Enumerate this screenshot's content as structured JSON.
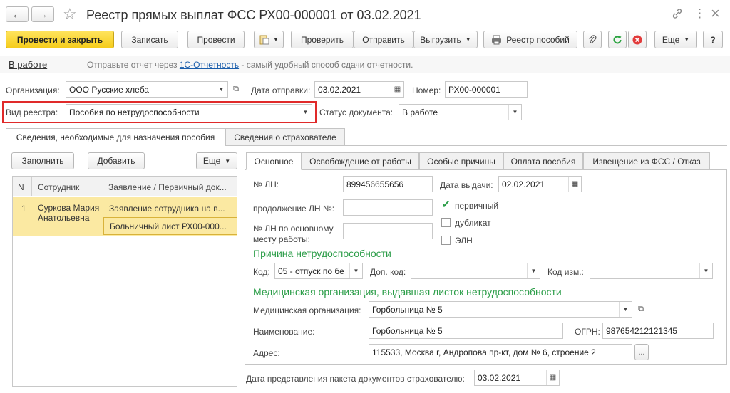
{
  "window": {
    "title": "Реестр прямых выплат ФСС РХ00-000001 от 03.02.2021",
    "back_icon": "←",
    "forward_icon": "→",
    "star_icon": "☆",
    "link_icon": "🔗",
    "menu_icon": "⋮",
    "close_icon": "×"
  },
  "toolbar": {
    "post_close": "Провести и закрыть",
    "save": "Записать",
    "post": "Провести",
    "check": "Проверить",
    "send": "Отправить",
    "export": "Выгрузить",
    "registry": "Реестр пособий",
    "more": "Еще",
    "help": "?"
  },
  "status_bar": {
    "status_link": "В работе",
    "hint_prefix": "Отправьте отчет через ",
    "hint_link": "1С-Отчетность",
    "hint_suffix": " - самый удобный способ сдачи отчетности."
  },
  "form": {
    "org_label": "Организация:",
    "org_value": "ООО Русские хлеба",
    "send_date_label": "Дата отправки:",
    "send_date_value": "03.02.2021",
    "number_label": "Номер:",
    "number_value": "РХ00-000001",
    "registry_type_label": "Вид реестра:",
    "registry_type_value": "Пособия по нетрудоспособности",
    "doc_status_label": "Статус документа:",
    "doc_status_value": "В работе"
  },
  "main_tabs": [
    "Сведения, необходимые для назначения пособия",
    "Сведения о страхователе"
  ],
  "left_panel": {
    "fill_button": "Заполнить",
    "add_button": "Добавить",
    "more_button": "Еще",
    "columns": [
      "N",
      "Сотрудник",
      "Заявление / Первичный док..."
    ],
    "rows": [
      {
        "n": "1",
        "employee": "Суркова Мария Анатольевна",
        "doc1": "Заявление сотрудника на в...",
        "doc2": "Больничный лист РХ00-000..."
      }
    ]
  },
  "detail_tabs": [
    "Основное",
    "Освобождение от работы",
    "Особые причины",
    "Оплата пособия",
    "Извещение из ФСС / Отказ"
  ],
  "detail": {
    "ln_label": "№ ЛН:",
    "ln_value": "899456655656",
    "issue_date_label": "Дата выдачи:",
    "issue_date_value": "02.02.2021",
    "continuation_label": "продолжение ЛН №:",
    "main_ln_label_1": "№ ЛН по основному",
    "main_ln_label_2": "месту работы:",
    "primary_label": "первичный",
    "duplicate_label": "дубликат",
    "eln_label": "ЭЛН",
    "reason_title": "Причина нетрудоспособности",
    "code_label": "Код:",
    "code_value": "05 - отпуск по бе",
    "extra_code_label": "Доп. код:",
    "change_code_label": "Код изм.:",
    "medorg_title": "Медицинская организация, выдавшая листок нетрудоспособности",
    "medorg_label": "Медицинская организация:",
    "medorg_value": "Горбольница № 5",
    "name_label": "Наименование:",
    "name_value": "Горбольница № 5",
    "ogrn_label": "ОГРН:",
    "ogrn_value": "987654212121345",
    "address_label": "Адрес:",
    "address_value": "115533, Москва г, Андропова пр-кт, дом № 6, строение 2",
    "address_button": "...",
    "submission_label": "Дата представления пакета документов страхователю:",
    "submission_value": "03.02.2021"
  },
  "colors": {
    "primary_button": "#f5cc1c",
    "section_title": "#2b9d48",
    "highlight_border": "#e02a2a",
    "selected_row": "#fbe9a2",
    "link": "#1a5dab"
  }
}
